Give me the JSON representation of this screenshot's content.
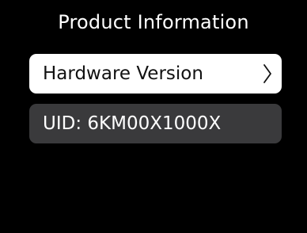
{
  "header": {
    "title": "Product Information"
  },
  "menu": {
    "items": [
      {
        "label": "Hardware Version",
        "icon": "chevron-right-icon",
        "selected": true
      },
      {
        "label": "UID: 6KM00X1000X",
        "selected": false
      }
    ]
  },
  "colors": {
    "background": "#000000",
    "selected_row": "#ffffff",
    "row": "#3a3a3c",
    "text_light": "#ffffff",
    "text_dark": "#111111"
  }
}
